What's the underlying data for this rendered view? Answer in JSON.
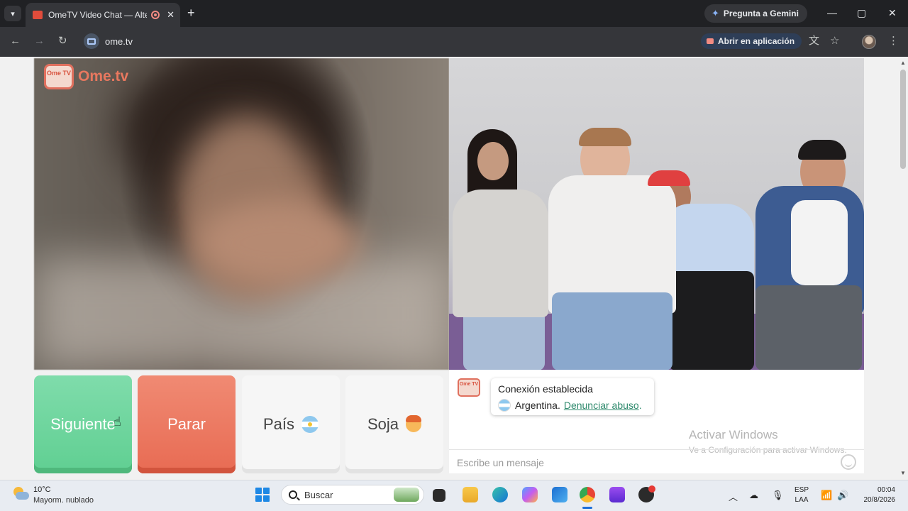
{
  "browser": {
    "tab_title": "OmeTV Video Chat — Alternativa",
    "tab_close": "✕",
    "new_tab": "+",
    "gemini_label": "Pregunta a Gemini",
    "url": "ome.tv",
    "open_in_app": "Abrir en aplicación",
    "window_minimize": "—",
    "window_maximize": "▢",
    "window_close": "✕"
  },
  "site": {
    "logo_badge": "Ome TV",
    "logo_text": "Ome.tv"
  },
  "controls": {
    "next": "Siguiente",
    "stop": "Parar",
    "country": "País",
    "gender": "Soja"
  },
  "chat": {
    "logo_badge": "Ome TV",
    "status": "Conexión establecida",
    "country": "Argentina",
    "separator": " .",
    "report": "Denunciar abuso",
    "report_end": ".",
    "placeholder": "Escribe un mensaje"
  },
  "watermark": {
    "title": "Activar Windows",
    "subtitle": "Ve a Configuración para activar Windows."
  },
  "taskbar": {
    "temperature": "10°C",
    "condition": "Mayorm. nublado",
    "search_label": "Buscar",
    "lang_top": "ESP",
    "lang_bottom": "LAA",
    "time": "00:04",
    "date": "20/8/2026"
  },
  "colors": {
    "next": "#60cf92",
    "stop": "#e86b53",
    "report_link": "#2f8a6d",
    "brand": "#e8785f"
  }
}
